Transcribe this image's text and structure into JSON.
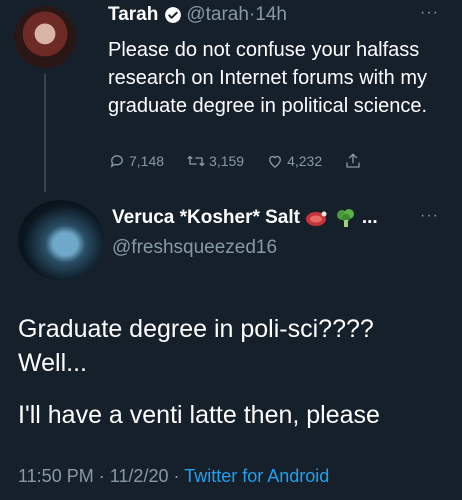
{
  "tweet1": {
    "name": "Tarah",
    "handle": "@tarah",
    "separator": "·",
    "time": "14h",
    "more": "···",
    "text": "Please do not confuse your halfass research on Internet forums with my graduate degree in political science.",
    "replies": "7,148",
    "retweets": "3,159",
    "likes": "4,232"
  },
  "tweet2": {
    "name": "Veruca *Kosher* Salt",
    "ellipsis": "...",
    "more": "···",
    "handle": "@freshsqueezed16",
    "line1": "Graduate degree in poli-sci????",
    "line2": "Well...",
    "line3": "I'll have a venti latte then, please",
    "time": "11:50 PM",
    "separator": "·",
    "date": "11/2/20",
    "source": "Twitter for Android"
  },
  "colors": {
    "background": "#15202b",
    "muted": "#8899a6",
    "accent": "#1da1f2"
  }
}
